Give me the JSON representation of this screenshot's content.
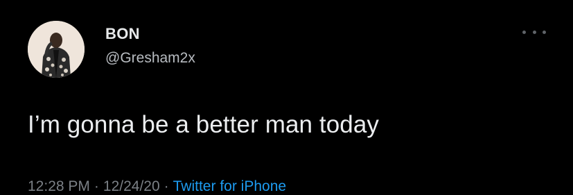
{
  "tweet": {
    "display_name": "BON",
    "handle": "@Gresham2x",
    "text": "I’m gonna be a better man today",
    "time": "12:28 PM",
    "date": "12/24/20",
    "separator": "·",
    "source": "Twitter for iPhone",
    "avatar_icon": "profile-avatar",
    "more_icon": "more-options-icon"
  },
  "colors": {
    "background": "#000000",
    "text": "#e7e9ea",
    "secondary": "#7b8086",
    "link": "#1d9bf0"
  }
}
